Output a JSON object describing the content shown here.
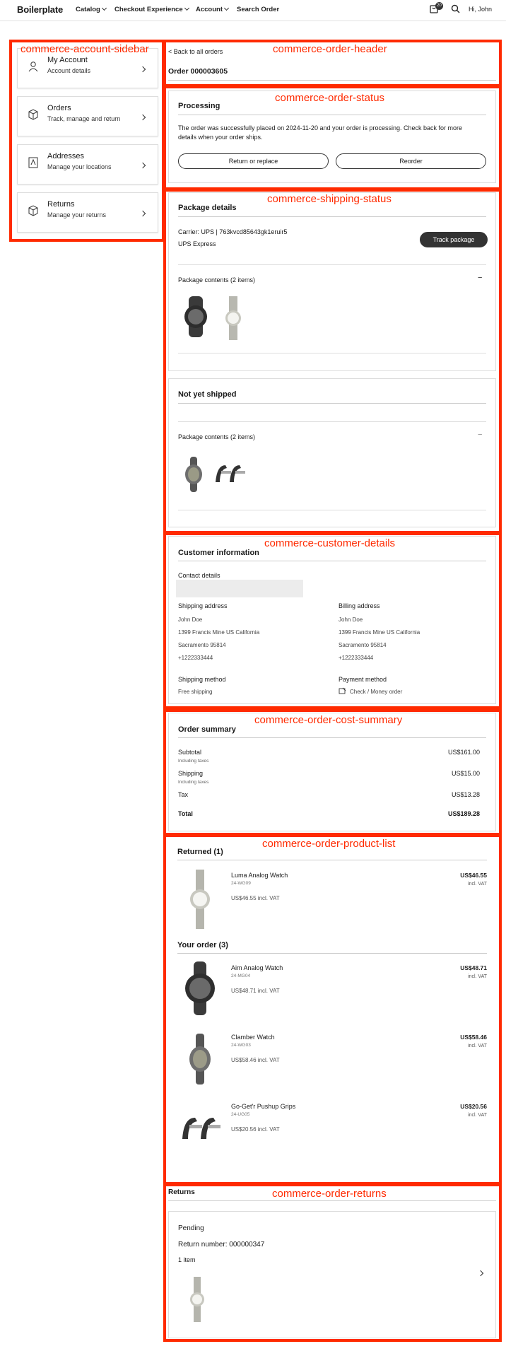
{
  "header": {
    "brand": "Boilerplate",
    "nav": [
      "Catalog",
      "Checkout Experience",
      "Account",
      "Search Order"
    ],
    "cart_count": "20",
    "greeting": "Hi, John"
  },
  "overlays": {
    "sidebar": "commerce-account-sidebar",
    "order_header": "commerce-order-header",
    "order_status": "commerce-order-status",
    "shipping_status": "commerce-shipping-status",
    "customer_details": "commerce-customer-details",
    "cost_summary": "commerce-order-cost-summary",
    "product_list": "commerce-order-product-list",
    "returns": "commerce-order-returns"
  },
  "sidebar": {
    "items": [
      {
        "title": "My Account",
        "sub": "Account details",
        "icon": "user-icon"
      },
      {
        "title": "Orders",
        "sub": "Track, manage and return",
        "icon": "box-icon"
      },
      {
        "title": "Addresses",
        "sub": "Manage your locations",
        "icon": "address-icon"
      },
      {
        "title": "Returns",
        "sub": "Manage your returns",
        "icon": "return-box-icon"
      }
    ]
  },
  "order_header": {
    "back": "< Back to all orders",
    "order": "Order 000003605"
  },
  "order_status": {
    "title": "Processing",
    "message": "The order was successfully placed on 2024-11-20 and your order is processing. Check back for more details when your order ships.",
    "return_btn": "Return or replace",
    "reorder_btn": "Reorder"
  },
  "shipping": {
    "pkg1": {
      "title": "Package details",
      "carrier": "Carrier: UPS | 763kvcd85643gk1eruir5",
      "method": "UPS Express",
      "track": "Track package",
      "contents": "Package contents (2 items)",
      "toggle": "−"
    },
    "pkg2": {
      "title": "Not yet shipped",
      "contents": "Package contents (2 items)",
      "toggle": "−"
    }
  },
  "customer": {
    "title": "Customer information",
    "contact_label": "Contact details",
    "ship_label": "Shipping address",
    "bill_label": "Billing address",
    "addr": [
      "John  Doe",
      "1399 Francis Mine  US  California",
      "Sacramento  95814",
      "+1222333444"
    ],
    "ship_method_label": "Shipping method",
    "ship_method": "Free shipping",
    "pay_label": "Payment method",
    "pay": "Check / Money order"
  },
  "summary": {
    "title": "Order summary",
    "subtotal_l": "Subtotal",
    "subtotal": "US$161.00",
    "incl1": "Including taxes",
    "shipping_l": "Shipping",
    "shipping": "US$15.00",
    "incl2": "Including taxes",
    "tax_l": "Tax",
    "tax": "US$13.28",
    "total_l": "Total",
    "total": "US$189.28"
  },
  "products": {
    "returned_title": "Returned (1)",
    "order_title": "Your order (3)",
    "incl": "incl. VAT",
    "returned": [
      {
        "name": "Luma Analog Watch",
        "sku": "24-WG09",
        "price": "US$46.55",
        "line": "US$46.55 incl. VAT"
      }
    ],
    "items": [
      {
        "name": "Aim Analog Watch",
        "sku": "24-MG04",
        "price": "US$48.71",
        "line": "US$48.71 incl. VAT"
      },
      {
        "name": "Clamber Watch",
        "sku": "24-WG03",
        "price": "US$58.46",
        "line": "US$58.46 incl. VAT"
      },
      {
        "name": "Go-Get'r Pushup Grips",
        "sku": "24-UG05",
        "price": "US$20.56",
        "line": "US$20.56 incl. VAT"
      }
    ]
  },
  "returns": {
    "title": "Returns",
    "status": "Pending",
    "number": "Return number: 000000347",
    "count": "1 item"
  }
}
